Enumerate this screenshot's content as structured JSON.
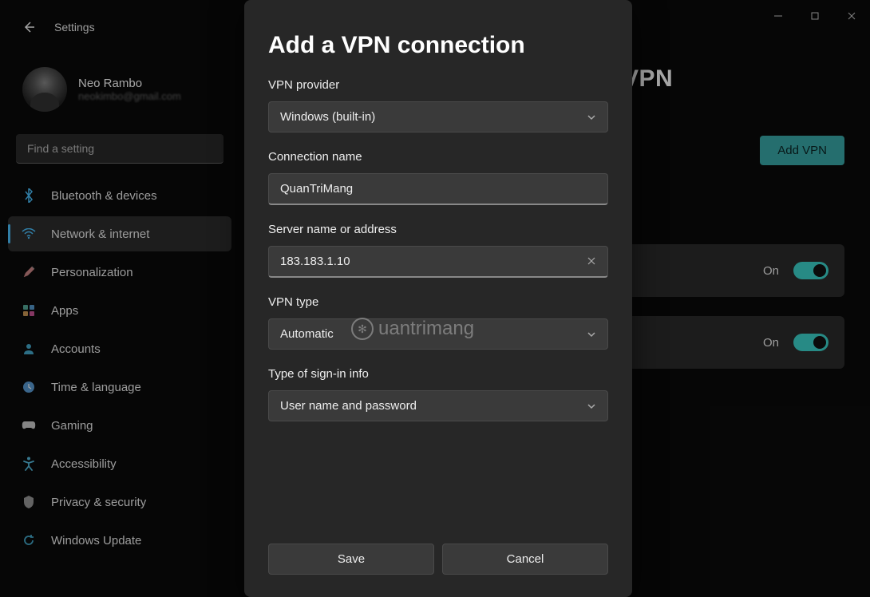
{
  "app_title": "Settings",
  "profile": {
    "name": "Neo Rambo",
    "email": "neokimbo@gmail.com"
  },
  "search": {
    "placeholder": "Find a setting"
  },
  "nav": [
    {
      "icon": "bluetooth",
      "label": "Bluetooth & devices"
    },
    {
      "icon": "wifi",
      "label": "Network & internet",
      "selected": true
    },
    {
      "icon": "brush",
      "label": "Personalization"
    },
    {
      "icon": "apps",
      "label": "Apps"
    },
    {
      "icon": "account",
      "label": "Accounts"
    },
    {
      "icon": "time",
      "label": "Time & language"
    },
    {
      "icon": "gaming",
      "label": "Gaming"
    },
    {
      "icon": "accessibility",
      "label": "Accessibility"
    },
    {
      "icon": "privacy",
      "label": "Privacy & security"
    },
    {
      "icon": "update",
      "label": "Windows Update"
    }
  ],
  "page": {
    "title_suffix": "VPN",
    "add_button": "Add VPN",
    "toggles": [
      {
        "label": "On",
        "state": true
      },
      {
        "label": "On",
        "state": true
      }
    ]
  },
  "dialog": {
    "title": "Add a VPN connection",
    "fields": {
      "provider_label": "VPN provider",
      "provider_value": "Windows (built-in)",
      "conn_name_label": "Connection name",
      "conn_name_value": "QuanTriMang",
      "server_label": "Server name or address",
      "server_value": "183.183.1.10",
      "vpn_type_label": "VPN type",
      "vpn_type_value": "Automatic",
      "signin_label": "Type of sign-in info",
      "signin_value": "User name and password"
    },
    "save": "Save",
    "cancel": "Cancel"
  },
  "watermark": "uantrimang",
  "colors": {
    "accent": "#4cc2ff",
    "teal": "#3aa9a9",
    "toggle": "#3dd4cc"
  }
}
